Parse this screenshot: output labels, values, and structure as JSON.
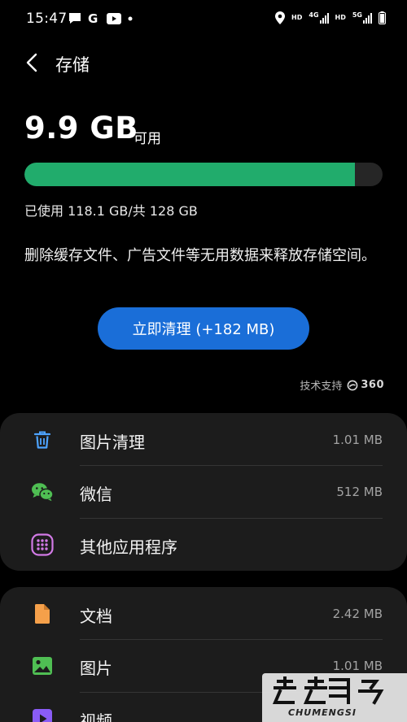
{
  "status_bar": {
    "time": "15:47",
    "left_icons": [
      "message-icon",
      "google-icon",
      "youtube-icon",
      "dot-icon"
    ],
    "right_icons": [
      "location-icon",
      "hd-icon",
      "4g-signal-icon",
      "hd-icon",
      "5g-signal-icon",
      "battery-icon"
    ],
    "hd_label": "HD",
    "net1": "4G",
    "net2": "5G"
  },
  "header": {
    "title": "存储",
    "back_icon": "chevron-left-icon"
  },
  "storage": {
    "free_amount": "9.9 GB",
    "free_label": "可用",
    "used_fraction": 0.923,
    "usage_text": "已使用 118.1 GB/共 128 GB",
    "description": "删除缓存文件、广告文件等无用数据来释放存储空间。",
    "clean_button": "立即清理 (+182 MB)",
    "powered_by": "技术支持",
    "provider": "360"
  },
  "colors": {
    "bar_fill": "#21ac6c",
    "button": "#1a6ed8",
    "card": "#1c1c1c"
  },
  "group1": [
    {
      "label": "图片清理",
      "size": "1.01 MB",
      "icon": "trash-icon"
    },
    {
      "label": "微信",
      "size": "512 MB",
      "icon": "wechat-icon"
    },
    {
      "label": "其他应用程序",
      "size": "",
      "icon": "apps-grid-icon"
    }
  ],
  "group2": [
    {
      "label": "文档",
      "size": "2.42 MB",
      "icon": "document-icon"
    },
    {
      "label": "图片",
      "size": "1.01 MB",
      "icon": "image-icon"
    },
    {
      "label": "视频",
      "size": "",
      "icon": "video-icon"
    }
  ],
  "watermark": {
    "text": "CHUMENGSI"
  }
}
